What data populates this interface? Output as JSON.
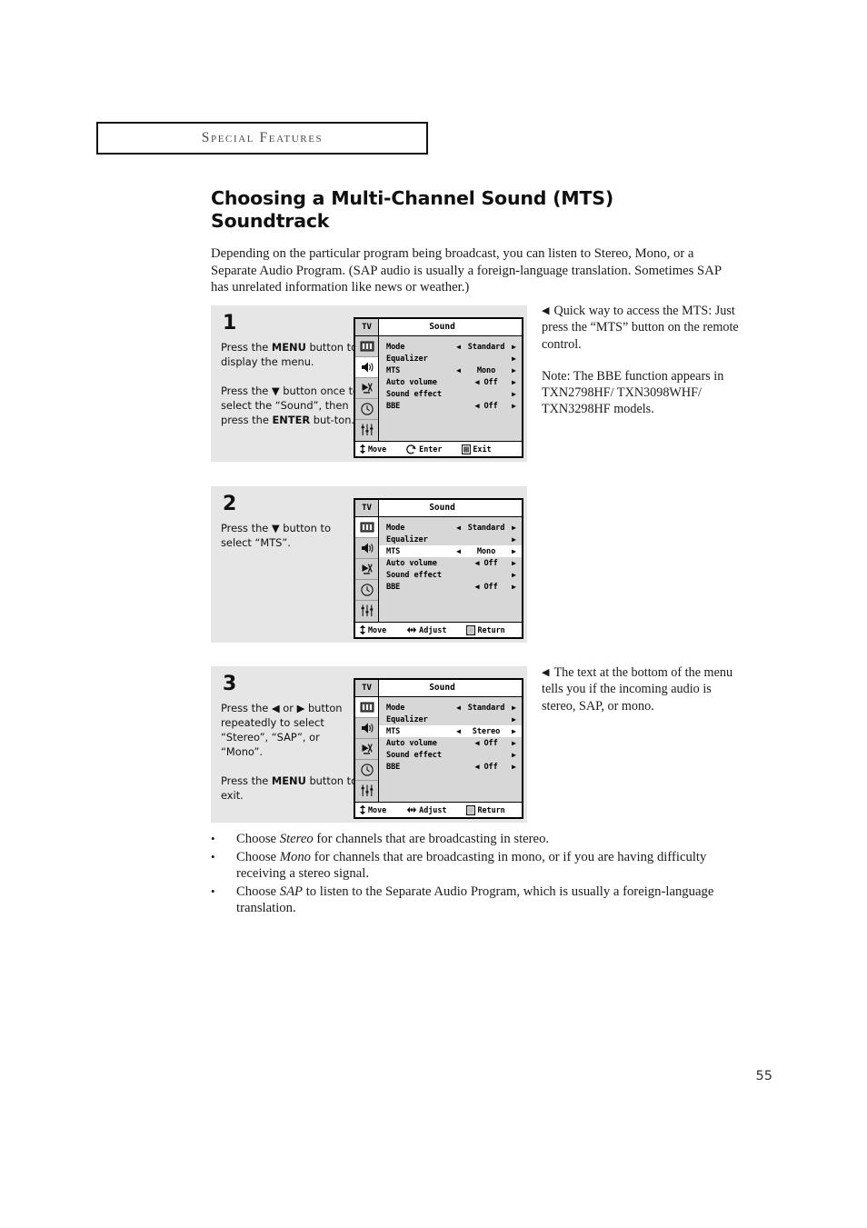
{
  "running_head": {
    "label": "Special Features"
  },
  "page_number": "55",
  "main": {
    "title": "Choosing a Multi-Channel Sound (MTS) Soundtrack",
    "intro": "Depending on the particular program being broadcast, you can listen to Stereo, Mono, or a Separate Audio Program. (SAP audio is usually a foreign-language translation. Sometimes SAP has unrelated information like news or weather.)"
  },
  "steps": [
    {
      "number": "1",
      "para1_a": "Press the ",
      "para1_b": "MENU",
      "para1_c": " button to display the menu.",
      "para2_a": "Press the ▼ button once to select the “Sound”, then press the ",
      "para2_b": "ENTER",
      "para2_c": " but-ton."
    },
    {
      "number": "2",
      "para1": "Press the ▼ button to select “MTS”."
    },
    {
      "number": "3",
      "para1": "Press the ◀ or ▶ button repeatedly to select “Stereo”, “SAP”, or “Mono”.",
      "para2_a": "Press the ",
      "para2_b": "MENU",
      "para2_c": " button to exit."
    }
  ],
  "osd": {
    "tv_label": "TV",
    "title": "Sound",
    "icons": [
      "picture-icon",
      "speaker-icon",
      "satellite-dish-icon",
      "clock-icon",
      "equalizer-icon"
    ],
    "screens": [
      {
        "selected_icon_index": 1,
        "highlight_row_index": -1,
        "rows": [
          {
            "label": "Mode",
            "left_arrow": "◀",
            "value": "Standard",
            "right_arrow": "▶"
          },
          {
            "label": "Equalizer",
            "left_arrow": "",
            "value": "",
            "right_arrow": "▶"
          },
          {
            "label": "MTS",
            "left_arrow": "◀",
            "value": "Mono",
            "right_arrow": "▶"
          },
          {
            "label": "Auto volume",
            "left_arrow": "",
            "value": "◀ Off",
            "right_arrow": "▶"
          },
          {
            "label": "Sound effect",
            "left_arrow": "",
            "value": "",
            "right_arrow": "▶"
          },
          {
            "label": "BBE",
            "left_arrow": "",
            "value": "◀ Off",
            "right_arrow": "▶"
          }
        ],
        "footer": [
          {
            "icon": "up-down-arrow-icon",
            "label": "Move"
          },
          {
            "icon": "enter-icon",
            "label": "Enter"
          },
          {
            "icon": "menu-bars-icon",
            "label": "Exit"
          }
        ]
      },
      {
        "selected_icon_index": 0,
        "highlight_row_index": 2,
        "rows": [
          {
            "label": "Mode",
            "left_arrow": "◀",
            "value": "Standard",
            "right_arrow": "▶"
          },
          {
            "label": "Equalizer",
            "left_arrow": "",
            "value": "",
            "right_arrow": "▶"
          },
          {
            "label": "MTS",
            "left_arrow": "◀",
            "value": "Mono",
            "right_arrow": "▶"
          },
          {
            "label": "Auto volume",
            "left_arrow": "",
            "value": "◀ Off",
            "right_arrow": "▶"
          },
          {
            "label": "Sound effect",
            "left_arrow": "",
            "value": "",
            "right_arrow": "▶"
          },
          {
            "label": "BBE",
            "left_arrow": "",
            "value": "◀ Off",
            "right_arrow": "▶"
          }
        ],
        "footer": [
          {
            "icon": "up-down-arrow-icon",
            "label": "Move"
          },
          {
            "icon": "left-right-arrow-icon",
            "label": "Adjust"
          },
          {
            "icon": "return-square-icon",
            "label": "Return"
          }
        ]
      },
      {
        "selected_icon_index": 0,
        "highlight_row_index": 2,
        "rows": [
          {
            "label": "Mode",
            "left_arrow": "◀",
            "value": "Standard",
            "right_arrow": "▶"
          },
          {
            "label": "Equalizer",
            "left_arrow": "",
            "value": "",
            "right_arrow": "▶"
          },
          {
            "label": "MTS",
            "left_arrow": "◀",
            "value": "Stereo",
            "right_arrow": "▶"
          },
          {
            "label": "Auto volume",
            "left_arrow": "",
            "value": "◀ Off",
            "right_arrow": "▶"
          },
          {
            "label": "Sound effect",
            "left_arrow": "",
            "value": "",
            "right_arrow": "▶"
          },
          {
            "label": "BBE",
            "left_arrow": "",
            "value": "◀ Off",
            "right_arrow": "▶"
          }
        ],
        "footer": [
          {
            "icon": "up-down-arrow-icon",
            "label": "Move"
          },
          {
            "icon": "left-right-arrow-icon",
            "label": "Adjust"
          },
          {
            "icon": "return-square-icon",
            "label": "Return"
          }
        ]
      }
    ]
  },
  "side_notes": {
    "note1_p1": "Quick way to access the MTS: Just press the “MTS” button on the remote control.",
    "note1_p2": "Note: The BBE function appears in TXN2798HF/ TXN3098WHF/ TXN3298HF models.",
    "note2_p1": "The text at the bottom of the menu tells you if the incoming audio is stereo, SAP, or mono.",
    "triangle": "◀"
  },
  "bullets": [
    {
      "dot": "•",
      "pre": "Choose ",
      "em": "Stereo",
      "post": " for channels that are broadcasting in stereo."
    },
    {
      "dot": "•",
      "pre": "Choose ",
      "em": "Mono",
      "post": " for channels that are broadcasting in mono, or if you are having difficulty receiving a stereo signal."
    },
    {
      "dot": "•",
      "pre": "Choose ",
      "em": "SAP",
      "post": " to listen to the Separate Audio Program, which is usually a foreign-language translation."
    }
  ]
}
